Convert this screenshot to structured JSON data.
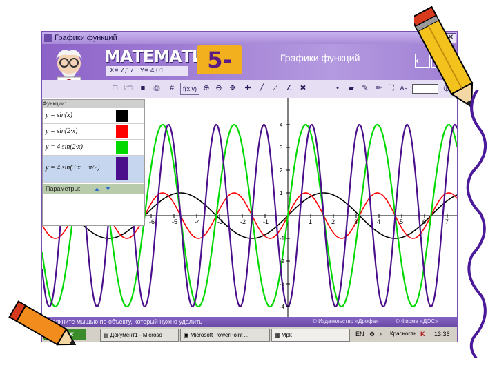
{
  "window": {
    "title": "Графики функций",
    "brand": "МАТЕМАТИКА",
    "grade": "5-11",
    "banner_title": "Графики функций",
    "coord_x": "X= 7,17",
    "coord_y": "Y= 4,01"
  },
  "toolbar": {
    "fxy_label": "f(x,y)",
    "text_tool_label": "Aa"
  },
  "functions_panel": {
    "header": "Функции:",
    "items": [
      {
        "formula": "y = sin(x)",
        "color": "#000000"
      },
      {
        "formula": "y = sin(2·x)",
        "color": "#ff0000"
      },
      {
        "formula": "y = 4·sin(2·x)",
        "color": "#00d800"
      },
      {
        "formula": "y = 4·sin(3·x − π/2)",
        "color": "#4b0f8c"
      }
    ],
    "params_label": "Параметры:"
  },
  "graph": {
    "x_ticks": [
      "-6",
      "-5",
      "-4",
      "-3",
      "-2",
      "-1",
      "1",
      "2",
      "3",
      "4",
      "5",
      "6",
      "7"
    ],
    "y_ticks": [
      "4",
      "3",
      "2",
      "1",
      "-1",
      "-2",
      "-3",
      "-4"
    ]
  },
  "status": {
    "hint": "Щелкните мышью по объекту, который нужно удалить",
    "copy1": "© Издательство «Дрофа»",
    "copy2": "© Фирма «ДОС»"
  },
  "taskbar": {
    "start": "пуск",
    "tasks": [
      "Документ1 - Microso",
      "Microsoft PowerPoint ...",
      "Mpk"
    ],
    "lang": "EN",
    "clock": "13:36",
    "sound_label": "Красность"
  },
  "colors": {
    "accent": "#8c62c8",
    "panel_param": "#b8ccab"
  }
}
